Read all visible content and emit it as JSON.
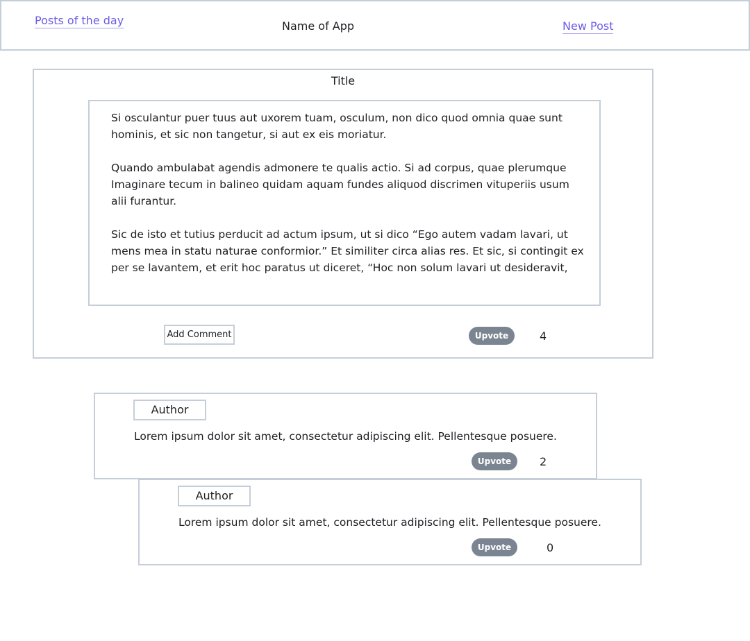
{
  "header": {
    "left_link": "Posts of the day",
    "app_name": "Name of App",
    "right_link": "New Post"
  },
  "post": {
    "title": "Title",
    "paragraphs": [
      "Si osculantur puer tuus aut uxorem tuam, osculum, non dico quod omnia quae sunt hominis, et sic non tangetur, si aut ex eis moriatur.",
      "Quando ambulabat agendis admonere te qualis actio. Si ad corpus, quae plerumque Imaginare tecum in balineo quidam aquam fundes aliquod discrimen vituperiis usum alii furantur.",
      "Sic de isto et tutius perducit ad actum ipsum, ut si dico “Ego autem vadam lavari, ut mens mea in statu naturae conformior.” Et similiter circa alias res. Et sic, si contingit ex per se lavantem, et erit hoc paratus ut diceret, “Hoc non solum lavari ut desideravit,"
    ],
    "add_comment_label": "Add Comment",
    "upvote_label": "Upvote",
    "upvote_count": "4"
  },
  "comments": [
    {
      "author": "Author",
      "text": "Lorem ipsum dolor sit amet, consectetur adipiscing elit. Pellentesque posuere.",
      "upvote_label": "Upvote",
      "upvote_count": "2"
    },
    {
      "author": "Author",
      "text": "Lorem ipsum dolor sit amet, consectetur adipiscing elit. Pellentesque posuere.",
      "upvote_label": "Upvote",
      "upvote_count": "0"
    }
  ],
  "colors": {
    "link": "#6b5ce7",
    "border": "#c5ced8",
    "upvote_bg": "#7b8592",
    "text": "#1f1f24"
  }
}
